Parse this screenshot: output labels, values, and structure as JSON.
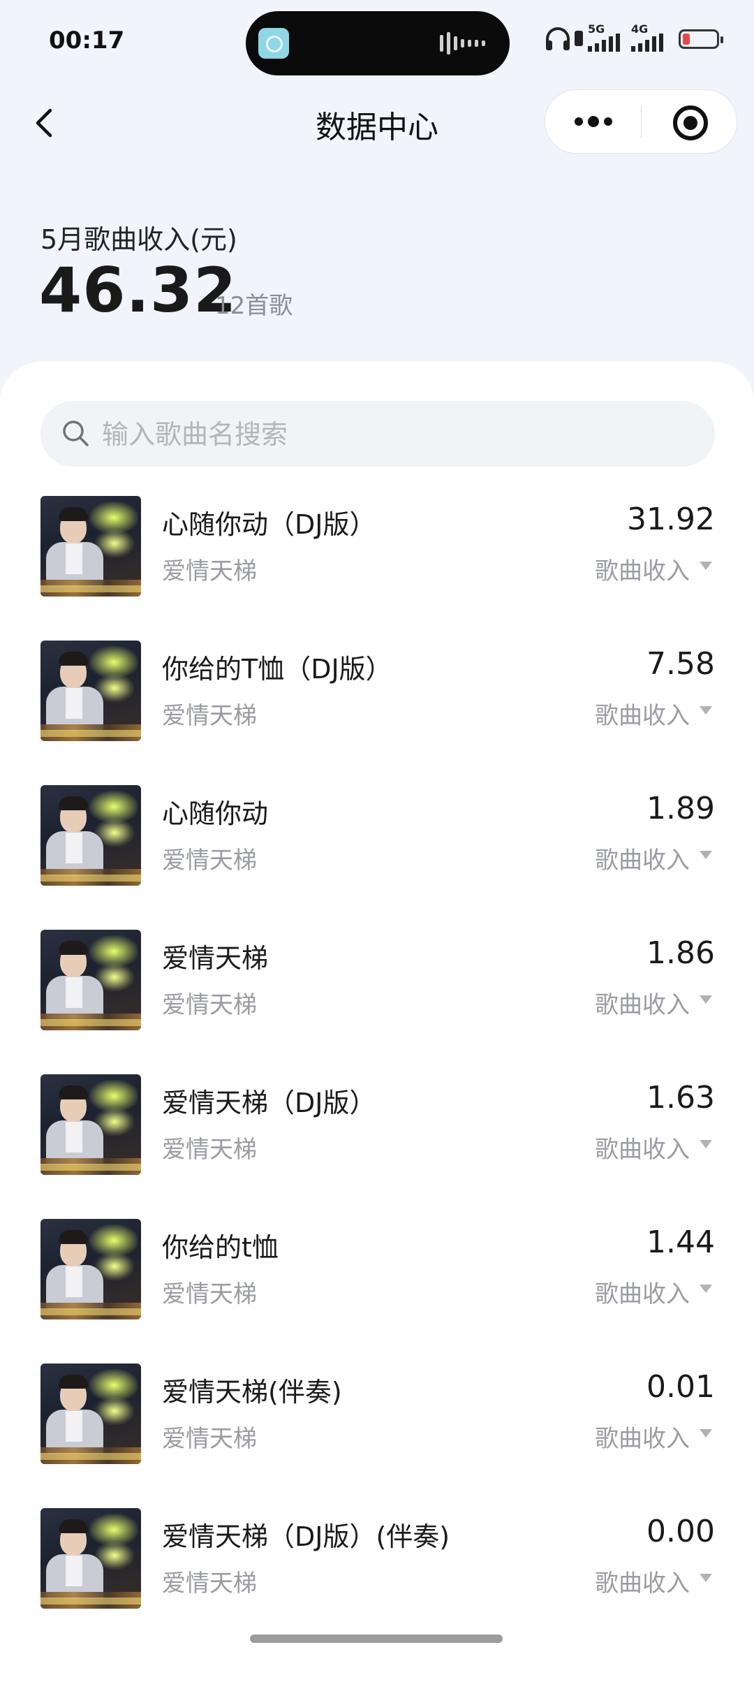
{
  "status_bar": {
    "time": "00:17",
    "network_1": "5G",
    "network_2": "4G",
    "battery_color": "#e5484d"
  },
  "nav": {
    "title": "数据中心",
    "back_icon": "chevron-left-icon",
    "more_icon": "more-dots-icon",
    "close_icon": "target-close-icon"
  },
  "summary": {
    "label": "5月歌曲收入(元)",
    "amount": "46.32",
    "count_text": "12首歌"
  },
  "search": {
    "placeholder": "输入歌曲名搜索",
    "value": ""
  },
  "songs": [
    {
      "title": "心随你动（DJ版）",
      "artist": "爱情天梯",
      "value": "31.92",
      "filter_label": "歌曲收入"
    },
    {
      "title": "你给的T恤（DJ版）",
      "artist": "爱情天梯",
      "value": "7.58",
      "filter_label": "歌曲收入"
    },
    {
      "title": "心随你动",
      "artist": "爱情天梯",
      "value": "1.89",
      "filter_label": "歌曲收入"
    },
    {
      "title": "爱情天梯",
      "artist": "爱情天梯",
      "value": "1.86",
      "filter_label": "歌曲收入"
    },
    {
      "title": "爱情天梯（DJ版）",
      "artist": "爱情天梯",
      "value": "1.63",
      "filter_label": "歌曲收入"
    },
    {
      "title": "你给的t恤",
      "artist": "爱情天梯",
      "value": "1.44",
      "filter_label": "歌曲收入"
    },
    {
      "title": "爱情天梯(伴奏)",
      "artist": "爱情天梯",
      "value": "0.01",
      "filter_label": "歌曲收入"
    },
    {
      "title": "爱情天梯（DJ版）(伴奏)",
      "artist": "爱情天梯",
      "value": "0.00",
      "filter_label": "歌曲收入"
    }
  ]
}
